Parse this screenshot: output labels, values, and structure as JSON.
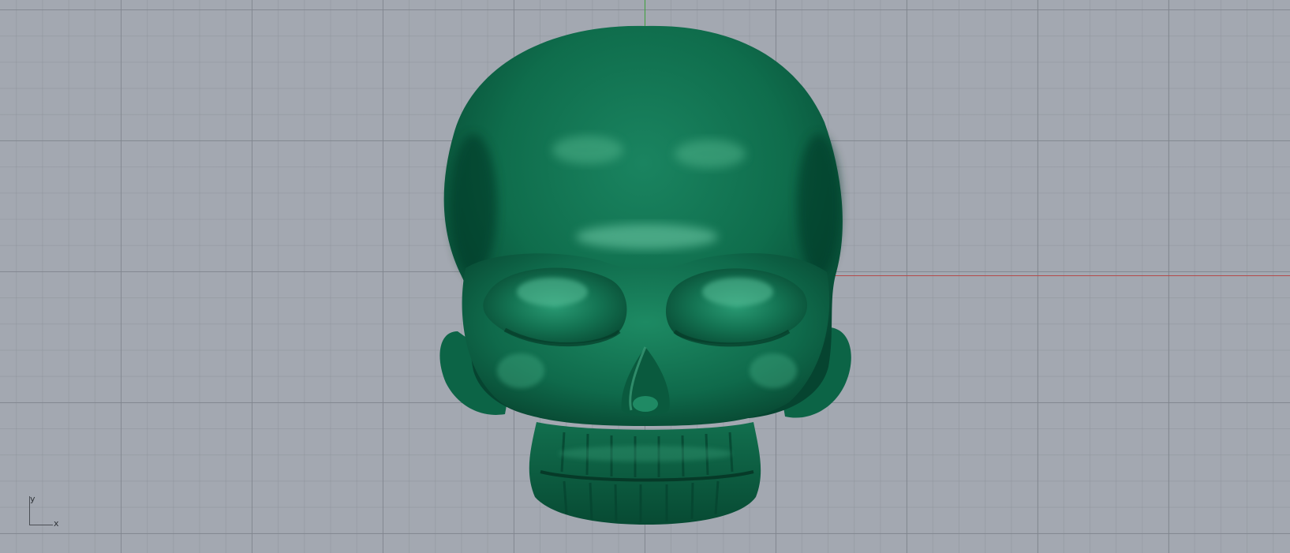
{
  "viewport": {
    "background": "#a3a8b1",
    "grid_color": "#80858e",
    "x_axis_color": "#b44a4a",
    "y_axis_color": "#3ea23e"
  },
  "model": {
    "object": "skull-mesh",
    "color": "#0d6a4a",
    "highlight": "#6cc8a4",
    "shadow": "#063a28"
  },
  "axis_widget": {
    "y_label": "y",
    "x_label": "x"
  }
}
